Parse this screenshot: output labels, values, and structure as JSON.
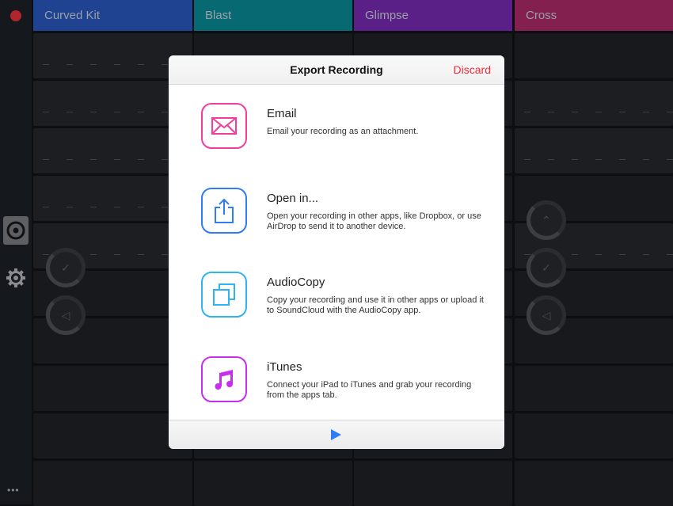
{
  "colors": {
    "record": "#b0262a",
    "accent": "#2f7cf6",
    "discard": "#f4293b"
  },
  "columns": [
    {
      "name": "Curved Kit",
      "color": "#1f4391"
    },
    {
      "name": "Blast",
      "color": "#076a72"
    },
    {
      "name": "Glimpse",
      "color": "#5a2088"
    },
    {
      "name": "Cross",
      "color": "#83204f"
    }
  ],
  "sidebar": {
    "icons": [
      "record-icon",
      "target-icon",
      "gear-icon",
      "more-icon"
    ],
    "more": "•••"
  },
  "modal": {
    "title": "Export Recording",
    "discard": "Discard",
    "items": [
      {
        "title": "Email",
        "desc": "Email your recording as an attachment.",
        "icon": "envelope-icon",
        "color": "#f23d9c"
      },
      {
        "title": "Open in...",
        "desc": "Open your recording in other apps, like Dropbox, or use AirDrop to send it to another device.",
        "icon": "share-icon",
        "color": "#2f7cf6"
      },
      {
        "title": "AudioCopy",
        "desc": "Copy your recording and use it in other apps or upload it to SoundCloud with the AudioCopy app.",
        "icon": "copy-icon",
        "color": "#2fb4f2"
      },
      {
        "title": "iTunes",
        "desc": "Connect your iPad to iTunes and grab your recording from the apps tab.",
        "icon": "music-note-icon",
        "color": "#c72ef0"
      }
    ],
    "footer": {
      "icon": "play-icon"
    }
  }
}
